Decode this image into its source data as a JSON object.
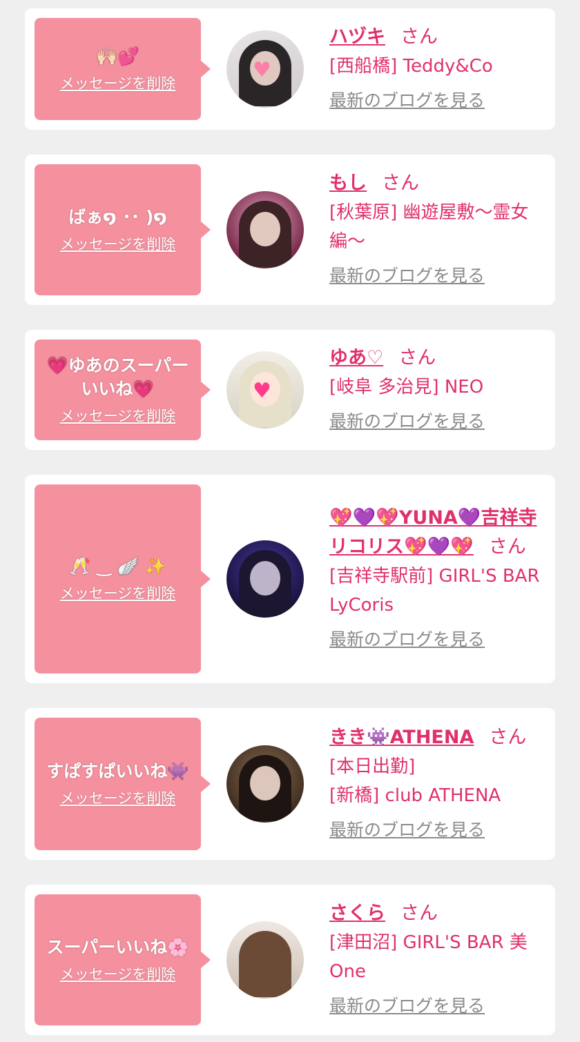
{
  "delete_label": "メッセージを削除",
  "san_label": "さん",
  "blog_label": "最新のブログを見る",
  "colors": {
    "bubble": "#f5919f",
    "accent": "#e0306a",
    "link_gray": "#8a8a8a",
    "page_bg": "#efefef"
  },
  "items": [
    {
      "message": "🙌🏻💕",
      "name": "ハヅキ",
      "shop_lines": [
        "[西船橋] Teddy&Co"
      ],
      "avatar_icon": "girl-photo-avatar"
    },
    {
      "message": "ばぁ໑ ･･ )໑",
      "name": "もし",
      "shop_lines": [
        "[秋葉原] 幽遊屋敷〜霊女編〜"
      ],
      "avatar_icon": "girl-photo-avatar"
    },
    {
      "message": "💗ゆあのスーパーいいね💗",
      "name": "ゆあ♡",
      "shop_lines": [
        "[岐阜 多治見] NEO"
      ],
      "avatar_icon": "girl-photo-avatar"
    },
    {
      "message": "🥂 ‿ 🪽 ✨",
      "name": "💖💜💖YUNA💜吉祥寺リコリス💖💜💖",
      "shop_lines": [
        "[吉祥寺駅前] GIRL'S BAR LyCoris"
      ],
      "avatar_icon": "girl-photo-avatar"
    },
    {
      "message": "すぱすぱいいね👾",
      "name": "きき👾ATHENA",
      "shop_lines": [
        "[本日出勤]",
        "[新橋] club ATHENA"
      ],
      "avatar_icon": "girl-photo-avatar"
    },
    {
      "message": "スーパーいいね🌸",
      "name": "さくら",
      "shop_lines": [
        "[津田沼] GIRL'S BAR 美One"
      ],
      "avatar_icon": "girl-photo-avatar"
    }
  ]
}
